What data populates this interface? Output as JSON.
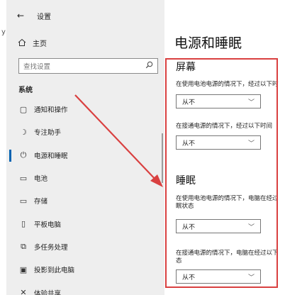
{
  "window": {
    "title": "设置",
    "back_icon": "←"
  },
  "left_glyph": "y",
  "sidebar": {
    "home_label": "主页",
    "search_placeholder": "查找设置",
    "section_label": "系统",
    "items": [
      {
        "label": "通知和操作",
        "icon": "notification-icon",
        "glyph": "▢"
      },
      {
        "label": "专注助手",
        "icon": "moon-icon",
        "glyph": "☽"
      },
      {
        "label": "电源和睡眠",
        "icon": "power-icon",
        "glyph": "⏻",
        "active": true
      },
      {
        "label": "电池",
        "icon": "battery-icon",
        "glyph": "▭"
      },
      {
        "label": "存储",
        "icon": "storage-icon",
        "glyph": "▭"
      },
      {
        "label": "平板电脑",
        "icon": "tablet-icon",
        "glyph": "▯"
      },
      {
        "label": "多任务处理",
        "icon": "multitask-icon",
        "glyph": "⧉"
      },
      {
        "label": "投影到此电脑",
        "icon": "project-icon",
        "glyph": "▣"
      },
      {
        "label": "体验共享",
        "icon": "share-icon",
        "glyph": "✕"
      }
    ]
  },
  "main": {
    "title": "电源和睡眠",
    "screen": {
      "heading": "屏幕",
      "battery_desc": "在使用电池电源的情况下，经过以下时",
      "battery_value": "从不",
      "plugged_desc": "在接通电源的情况下，经过以下时间",
      "plugged_value": "从不"
    },
    "sleep": {
      "heading": "睡眠",
      "battery_desc": "在使用电池电源的情况下，电脑在经过眠状态",
      "battery_value": "从不",
      "plugged_desc": "在接通电源的情况下，电脑在经过以下态",
      "plugged_value": "从不"
    }
  },
  "colors": {
    "accent": "#0063b1",
    "annotation": "#d94040",
    "sidebar_bg": "#eeeeee"
  }
}
